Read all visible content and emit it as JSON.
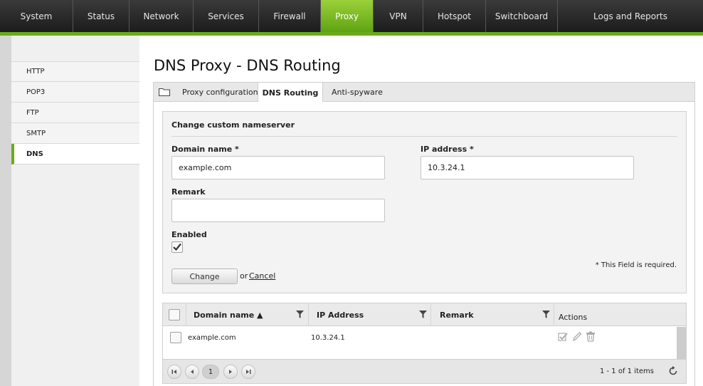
{
  "nav": {
    "items": [
      {
        "label": "System"
      },
      {
        "label": "Status"
      },
      {
        "label": "Network"
      },
      {
        "label": "Services"
      },
      {
        "label": "Firewall"
      },
      {
        "label": "Proxy"
      },
      {
        "label": "VPN"
      },
      {
        "label": "Hotspot"
      },
      {
        "label": "Switchboard"
      },
      {
        "label": "Logs and Reports"
      }
    ],
    "active": "Proxy",
    "accent_color": "#6aab1a"
  },
  "sidebar": {
    "items": [
      {
        "label": "HTTP"
      },
      {
        "label": "POP3"
      },
      {
        "label": "FTP"
      },
      {
        "label": "SMTP"
      },
      {
        "label": "DNS"
      }
    ],
    "active": "DNS"
  },
  "page": {
    "title": "DNS Proxy - DNS Routing"
  },
  "tabs": {
    "icon": "folder-icon",
    "items": [
      {
        "label": "Proxy configuration"
      },
      {
        "label": "DNS Routing"
      },
      {
        "label": "Anti-spyware"
      }
    ],
    "active": "DNS Routing"
  },
  "form": {
    "title": "Change custom nameserver",
    "domain_label": "Domain name *",
    "domain_value": "example.com",
    "ip_label": "IP address *",
    "ip_value": "10.3.24.1",
    "remark_label": "Remark",
    "remark_value": "",
    "enabled_label": "Enabled",
    "enabled_checked": true,
    "required_note": "* This Field is required.",
    "change_button": "Change",
    "or_text": "or",
    "cancel_link": "Cancel"
  },
  "grid": {
    "columns": [
      {
        "label": "Domain name ▲"
      },
      {
        "label": "IP Address"
      },
      {
        "label": "Remark"
      },
      {
        "label": "Actions"
      }
    ],
    "rows": [
      {
        "domain": "example.com",
        "ip": "10.3.24.1",
        "remark": ""
      }
    ],
    "row_action_icons": [
      "check-icon",
      "pencil-icon",
      "trash-icon"
    ],
    "pager": {
      "current_page": "1",
      "info": "1 - 1 of 1 items",
      "icons": [
        "first-page-icon",
        "prev-page-icon",
        "next-page-icon",
        "last-page-icon",
        "refresh-icon"
      ]
    }
  }
}
